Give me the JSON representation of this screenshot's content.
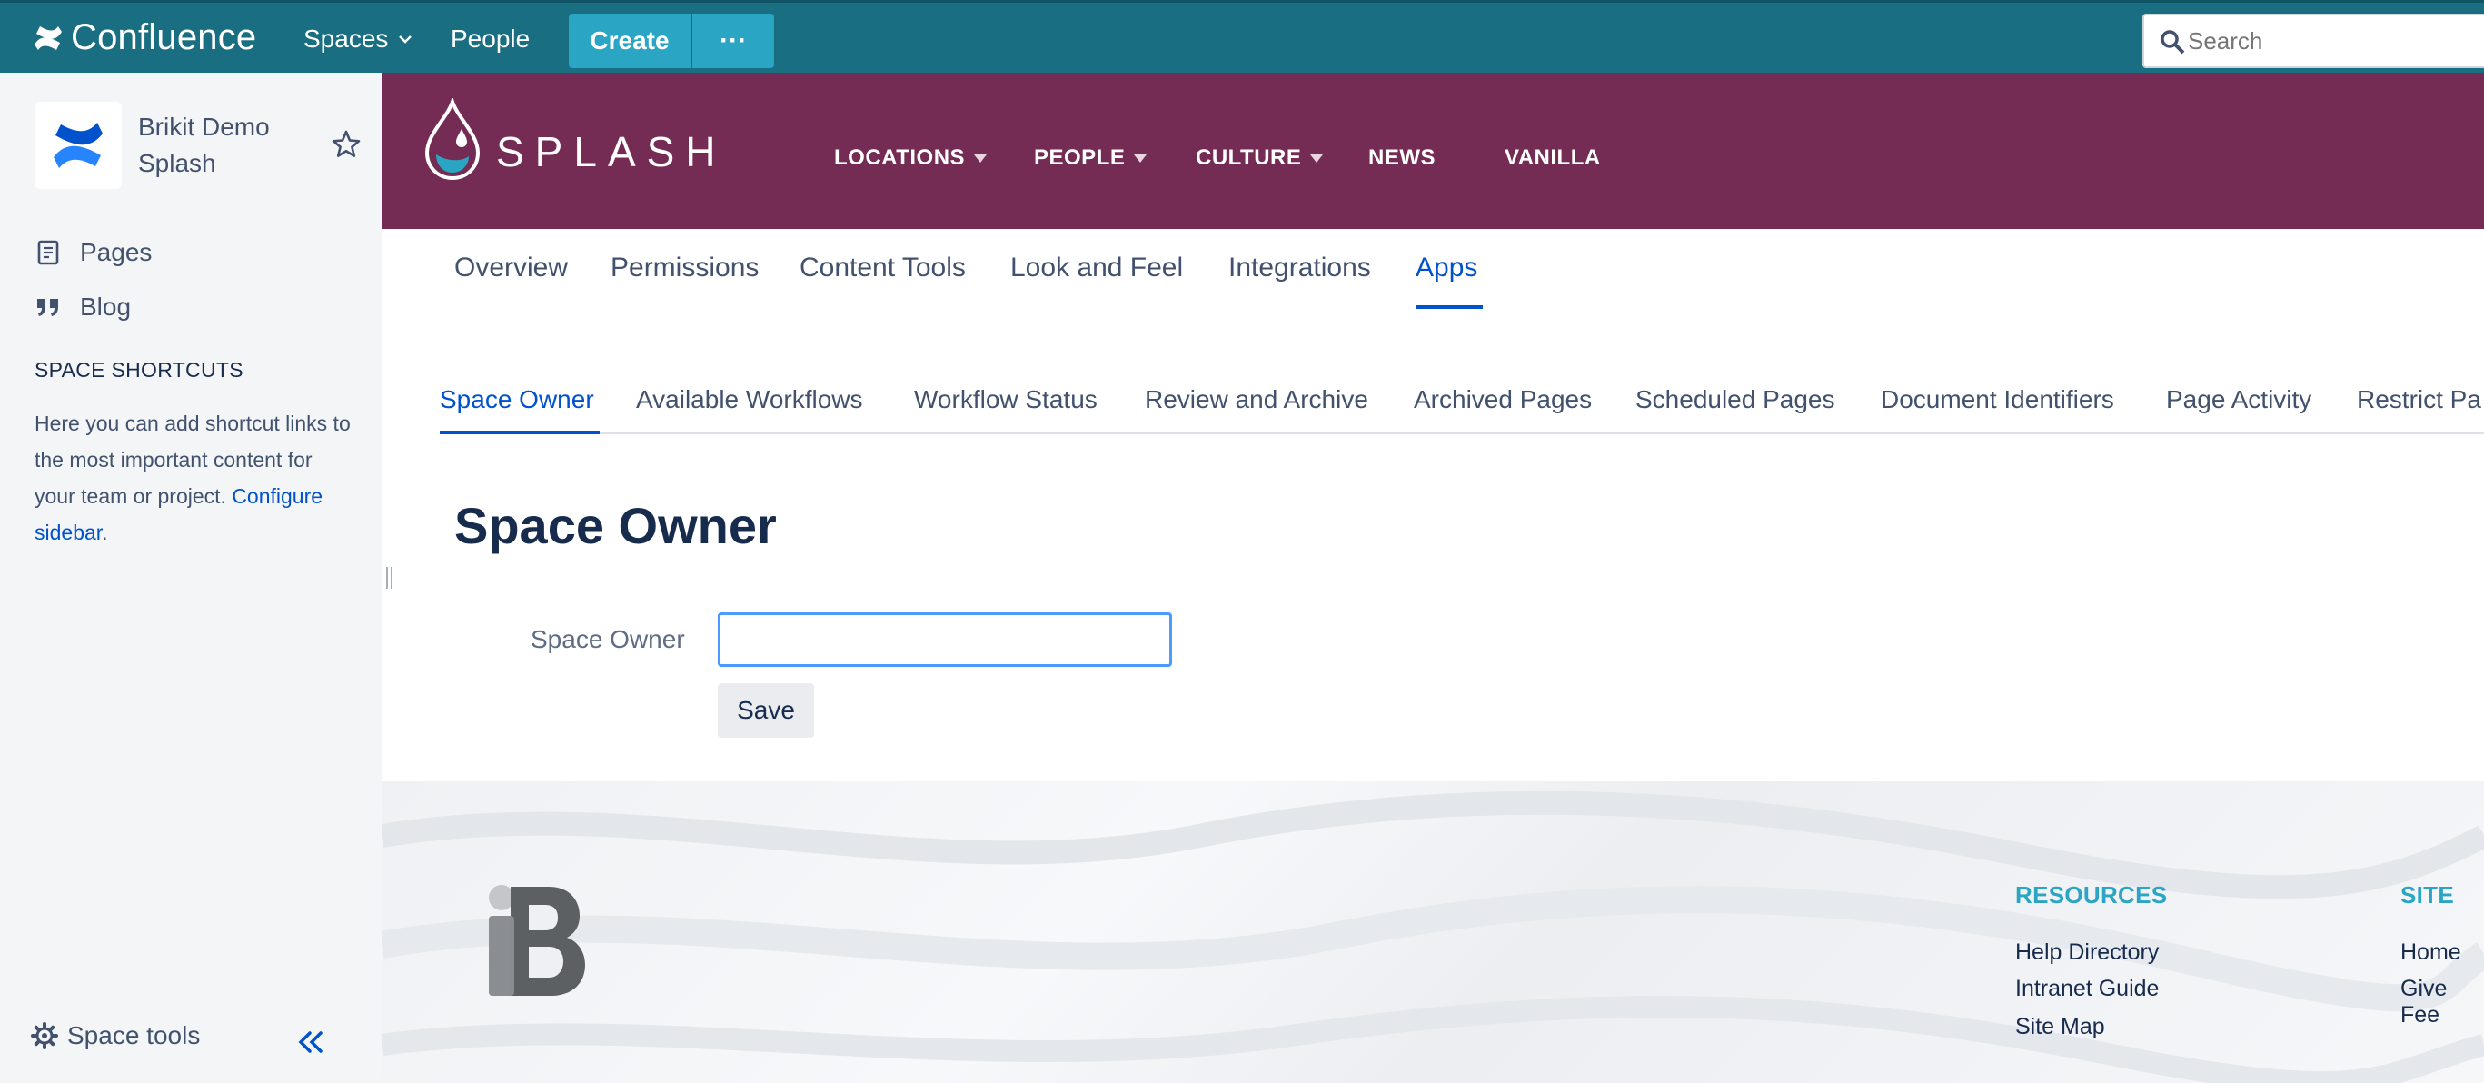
{
  "topbar": {
    "app_name": "Confluence",
    "spaces_label": "Spaces",
    "people_label": "People",
    "create_label": "Create",
    "more_label": "···",
    "search_placeholder": "Search",
    "bg_color": "#1a6e82",
    "button_color": "#2aa6c4"
  },
  "sidebar": {
    "space_name": "Brikit Demo Splash",
    "items": [
      {
        "label": "Pages",
        "icon": "page-icon"
      },
      {
        "label": "Blog",
        "icon": "quote-icon"
      }
    ],
    "shortcuts_title": "SPACE SHORTCUTS",
    "shortcuts_text": "Here you can add shortcut links to the most important content for your team or project.",
    "shortcuts_link": "Configure sidebar",
    "shortcuts_suffix": ".",
    "space_tools_label": "Space tools"
  },
  "banner": {
    "brand": "SPLASH",
    "bg_color": "#742c55",
    "nav": [
      {
        "label": "LOCATIONS",
        "has_dropdown": true
      },
      {
        "label": "PEOPLE",
        "has_dropdown": true
      },
      {
        "label": "CULTURE",
        "has_dropdown": true
      },
      {
        "label": "NEWS",
        "has_dropdown": false
      },
      {
        "label": "VANILLA",
        "has_dropdown": false
      }
    ]
  },
  "admin_tabs": [
    {
      "label": "Overview",
      "active": false
    },
    {
      "label": "Permissions",
      "active": false
    },
    {
      "label": "Content Tools",
      "active": false
    },
    {
      "label": "Look and Feel",
      "active": false
    },
    {
      "label": "Integrations",
      "active": false
    },
    {
      "label": "Apps",
      "active": true
    }
  ],
  "app_tabs": [
    {
      "label": "Space Owner",
      "active": true
    },
    {
      "label": "Available Workflows",
      "active": false
    },
    {
      "label": "Workflow Status",
      "active": false
    },
    {
      "label": "Review and Archive",
      "active": false
    },
    {
      "label": "Archived Pages",
      "active": false
    },
    {
      "label": "Scheduled Pages",
      "active": false
    },
    {
      "label": "Document Identifiers",
      "active": false
    },
    {
      "label": "Page Activity",
      "active": false
    },
    {
      "label": "Restrict Pa",
      "active": false
    }
  ],
  "form": {
    "title": "Space Owner",
    "field_label": "Space Owner",
    "field_value": "",
    "save_label": "Save",
    "focus_color": "#4c9aff"
  },
  "footer": {
    "columns": [
      {
        "heading": "RESOURCES",
        "links": [
          "Help Directory",
          "Intranet Guide",
          "Site Map"
        ]
      },
      {
        "heading": "SITE",
        "links": [
          "Home",
          "Give Fee"
        ]
      }
    ],
    "heading_color": "#2aa6c4"
  }
}
